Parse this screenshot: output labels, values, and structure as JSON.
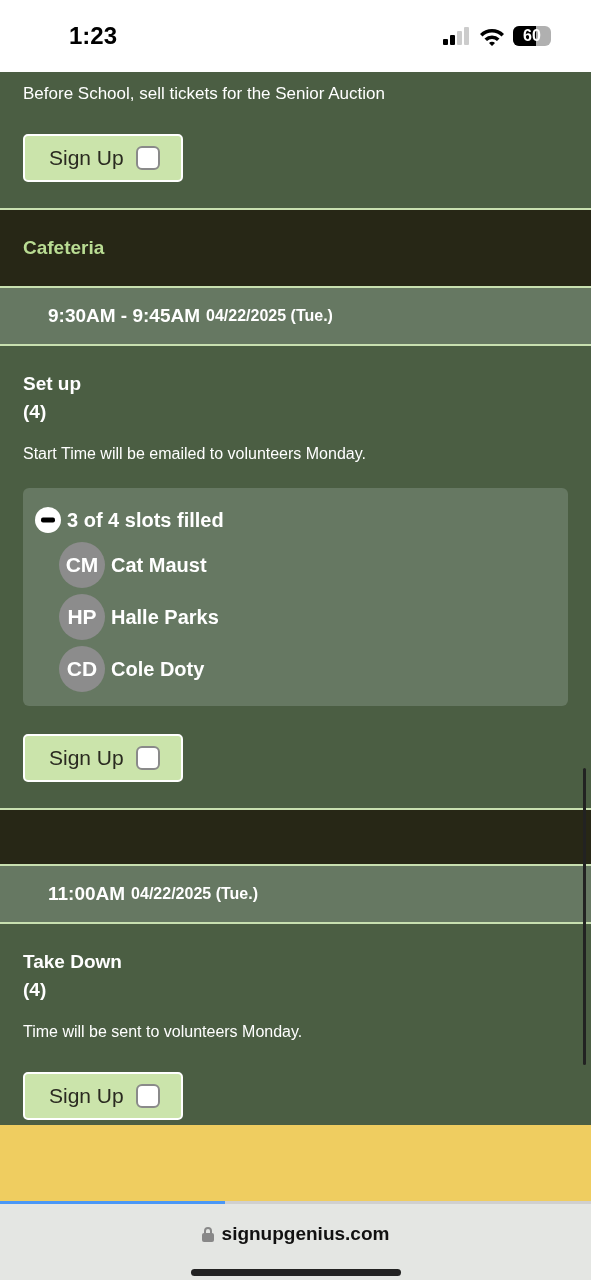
{
  "status_bar": {
    "time": "1:23",
    "battery": "60"
  },
  "feed": [
    {
      "kind": "text",
      "text": "Before School, sell tickets for the Senior Auction"
    },
    {
      "kind": "signup",
      "label": "Sign Up",
      "checked": false
    },
    {
      "kind": "category",
      "title": "Cafeteria"
    },
    {
      "kind": "time",
      "time": "9:30AM - 9:45AM",
      "date": "04/22/2025 (Tue.)"
    },
    {
      "kind": "task",
      "title": "Set up",
      "count": "(4)",
      "note": "Start Time will be emailed to volunteers Monday."
    },
    {
      "kind": "slots",
      "summary": "3 of 4 slots filled",
      "expanded": true,
      "people": [
        {
          "initials": "CM",
          "name": "Cat Maust"
        },
        {
          "initials": "HP",
          "name": "Halle Parks"
        },
        {
          "initials": "CD",
          "name": "Cole Doty"
        }
      ]
    },
    {
      "kind": "signup",
      "label": "Sign Up",
      "checked": false
    },
    {
      "kind": "category"
    },
    {
      "kind": "time",
      "time": "11:00AM",
      "date": "04/22/2025 (Tue.)"
    },
    {
      "kind": "task",
      "title": "Take Down",
      "count": "(4)",
      "note": "Time will be sent to volunteers Monday."
    },
    {
      "kind": "signup",
      "label": "Sign Up",
      "checked": false
    }
  ],
  "address_bar": {
    "url": "signupgenius.com",
    "level": 0.38
  }
}
